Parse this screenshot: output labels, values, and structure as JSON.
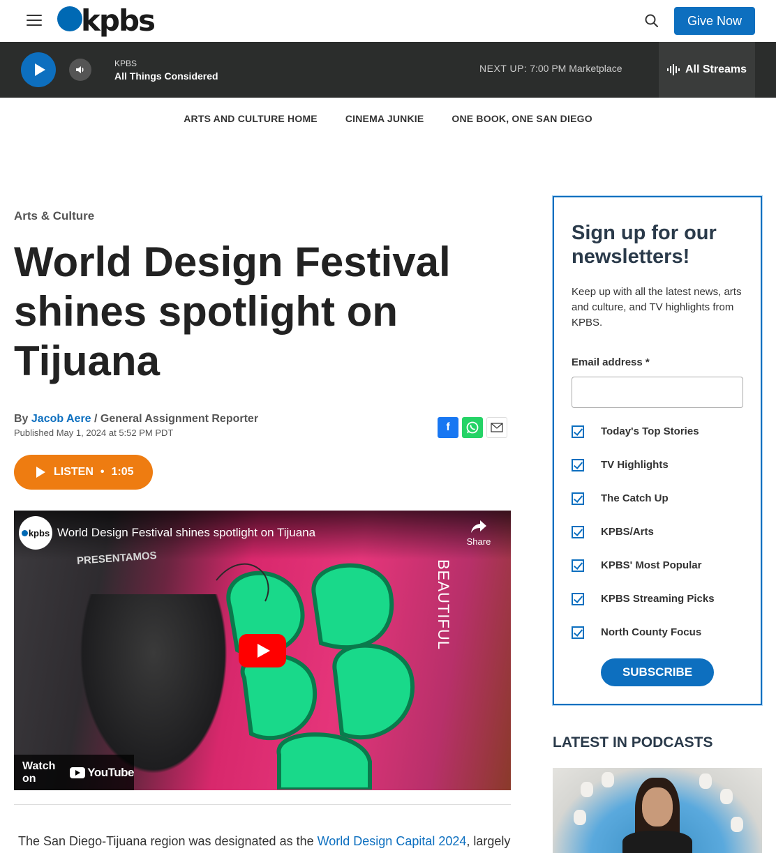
{
  "header": {
    "logo_text": "kpbs",
    "give_label": "Give Now"
  },
  "player": {
    "station": "KPBS",
    "show": "All Things Considered",
    "next_up_label": "NEXT UP:",
    "next_up_time": "7:00 PM",
    "next_up_show": "Marketplace",
    "streams_label": "All Streams"
  },
  "subnav": {
    "items": [
      "ARTS AND CULTURE HOME",
      "CINEMA JUNKIE",
      "ONE BOOK, ONE SAN DIEGO"
    ]
  },
  "article": {
    "kicker": "Arts & Culture",
    "headline": "World Design Festival shines spotlight on Tijuana",
    "by": "By",
    "author": "Jacob Aere",
    "author_role": "/ General Assignment Reporter",
    "published": "Published May 1, 2024 at 5:52 PM PDT",
    "listen_label": "LISTEN",
    "listen_sep": "•",
    "listen_duration": "1:05",
    "body_start": "The San Diego-Tijuana region was designated as the ",
    "body_link": "World Design Capital 2024",
    "body_end": ", largely"
  },
  "video": {
    "channel": "kpbs",
    "title": "World Design Festival shines spotlight on Tijuana",
    "share_label": "Share",
    "watch_on": "Watch on",
    "youtube": "YouTube",
    "sign_text_1": "PRESENTAMOS",
    "sign_text_2": "BEAUTIFUL"
  },
  "newsletter": {
    "title": "Sign up for our newsletters!",
    "description": "Keep up with all the latest news, arts and culture, and TV highlights from KPBS.",
    "email_label": "Email address *",
    "email_value": "",
    "options": [
      "Today's Top Stories",
      "TV Highlights",
      "The Catch Up",
      "KPBS/Arts",
      "KPBS' Most Popular",
      "KPBS Streaming Picks",
      "North County Focus"
    ],
    "subscribe_label": "SUBSCRIBE"
  },
  "podcasts": {
    "title": "LATEST IN PODCASTS"
  },
  "colors": {
    "brand_blue": "#0d6fbf",
    "listen_orange": "#ee7c11",
    "player_bg": "#2b2d2c"
  }
}
